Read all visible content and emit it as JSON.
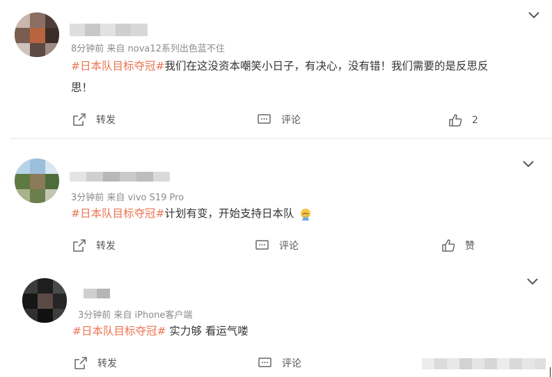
{
  "comments": [
    {
      "meta": "8分钟前  来自 nova12系列出色蓝不住",
      "topic": "#日本队目标夺冠#",
      "text_line1": "我们在这没资本嘲笑小日子，有决心，没有错！我们需要的是反思反",
      "text_line2": "思！",
      "repost_label": "转发",
      "comment_label": "评论",
      "like_label": "2"
    },
    {
      "meta": "3分钟前  来自 vivo S19 Pro",
      "topic": "#日本队目标夺冠#",
      "text": "计划有变，开始支持日本队",
      "emoji": "praying-face-emoji",
      "repost_label": "转发",
      "comment_label": "评论",
      "like_label": "赞"
    },
    {
      "meta": "3分钟前  来自 iPhone客户端",
      "topic": "#日本队目标夺冠#",
      "text": " 实力够 看运气喽",
      "repost_label": "转发",
      "comment_label": "评论"
    }
  ],
  "colors": {
    "topic": "#eb7350",
    "meta": "#8a8a8a",
    "text": "#333333",
    "divider": "#e6e6e6"
  },
  "icons": [
    "chevron-down-icon",
    "repost-icon",
    "comment-icon",
    "like-icon"
  ]
}
